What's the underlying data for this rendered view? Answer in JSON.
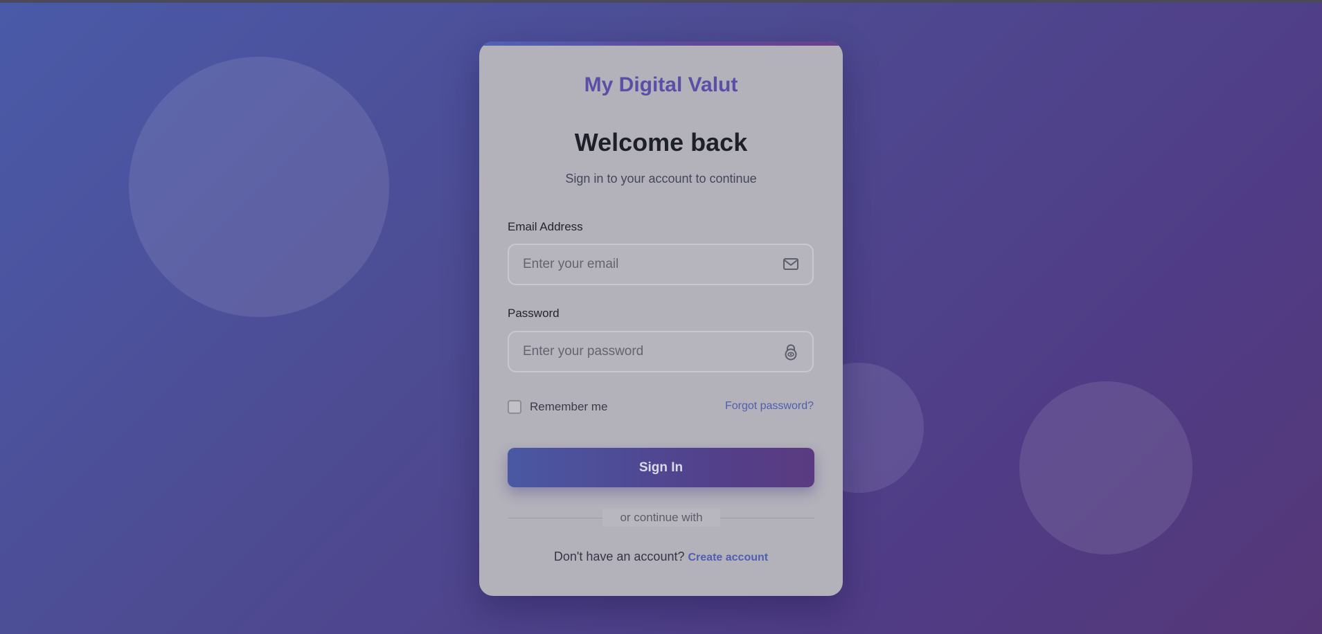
{
  "app": {
    "logo": "My Digital Valut"
  },
  "header": {
    "title": "Welcome back",
    "subtitle": "Sign in to your account to continue"
  },
  "form": {
    "email": {
      "label": "Email Address",
      "placeholder": "Enter your email",
      "value": "",
      "icon": "mail-icon"
    },
    "password": {
      "label": "Password",
      "placeholder": "Enter your password",
      "value": "",
      "icon": "lock-icon"
    },
    "remember": {
      "label": "Remember me",
      "checked": false
    },
    "forgot_label": "Forgot password?",
    "submit_label": "Sign In",
    "divider_text": "or continue with"
  },
  "footer": {
    "prompt": "Don't have an account?",
    "link_label": "Create account"
  },
  "colors": {
    "background_start": "#4a5aa8",
    "background_end": "#553778",
    "accent": "#4f5fb0",
    "logo": "#5a4fa6"
  }
}
